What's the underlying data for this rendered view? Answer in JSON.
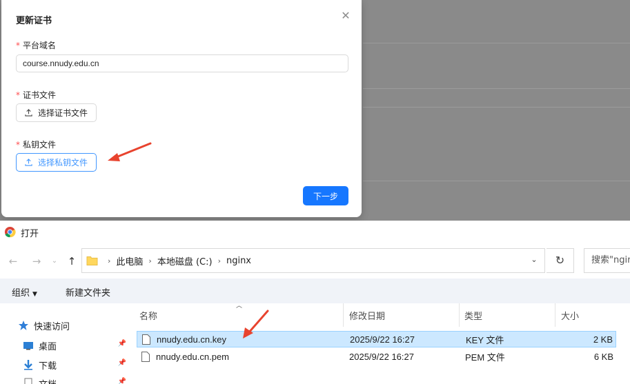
{
  "modal": {
    "title": "更新证书",
    "close": "✕",
    "required_mark": "*",
    "domain_label": "平台域名",
    "domain_value": "course.nnudy.edu.cn",
    "cert_label": "证书文件",
    "cert_button": "选择证书文件",
    "key_label": "私钥文件",
    "key_button": "选择私钥文件",
    "next_button": "下一步"
  },
  "dialog": {
    "title": "打开",
    "breadcrumb": [
      "此电脑",
      "本地磁盘 (C:)",
      "nginx"
    ],
    "search_placeholder": "搜索\"nginx\"",
    "toolbar": {
      "organize": "组织",
      "new_folder": "新建文件夹"
    },
    "sidebar": [
      {
        "label": "快速访问",
        "icon": "star-icon"
      },
      {
        "label": "桌面",
        "icon": "desktop-icon"
      },
      {
        "label": "下载",
        "icon": "download-icon"
      },
      {
        "label": "文档",
        "icon": "document-icon"
      }
    ],
    "columns": {
      "name": "名称",
      "date": "修改日期",
      "type": "类型",
      "size": "大小"
    },
    "files": [
      {
        "name": "nnudy.edu.cn.key",
        "date": "2025/9/22 16:27",
        "type": "KEY 文件",
        "size": "2 KB",
        "selected": true
      },
      {
        "name": "nnudy.edu.cn.pem",
        "date": "2025/9/22 16:27",
        "type": "PEM 文件",
        "size": "6 KB",
        "selected": false
      }
    ]
  },
  "colors": {
    "primary": "#1677ff",
    "required": "#ff4d4f",
    "selection": "#cce8ff",
    "annotation": "#e8432e"
  }
}
